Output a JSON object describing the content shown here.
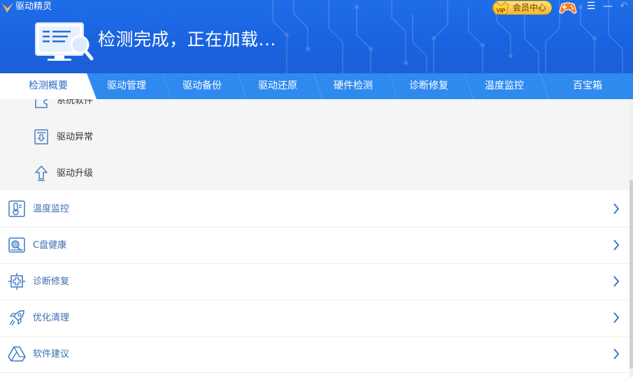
{
  "app": {
    "title": "驱动精灵",
    "vip_label": "会员中心",
    "vip_badge": "VIP"
  },
  "header": {
    "status": "检测完成，正在加载..."
  },
  "tabs": [
    {
      "label": "检测概要",
      "active": true
    },
    {
      "label": "驱动管理",
      "active": false
    },
    {
      "label": "驱动备份",
      "active": false
    },
    {
      "label": "驱动还原",
      "active": false
    },
    {
      "label": "硬件检测",
      "active": false
    },
    {
      "label": "诊断修复",
      "active": false
    },
    {
      "label": "温度监控",
      "active": false
    },
    {
      "label": "百宝箱",
      "active": false
    }
  ],
  "sub_items": [
    {
      "label": "系统软件",
      "icon": "puzzle-icon"
    },
    {
      "label": "驱动异常",
      "icon": "driver-exception-icon"
    },
    {
      "label": "驱动升级",
      "icon": "upgrade-arrow-icon"
    }
  ],
  "nav_rows": [
    {
      "label": "温度监控",
      "icon": "thermometer-icon"
    },
    {
      "label": "C盘健康",
      "icon": "disk-health-icon"
    },
    {
      "label": "诊断修复",
      "icon": "diagnose-repair-icon"
    },
    {
      "label": "优化清理",
      "icon": "rocket-icon"
    },
    {
      "label": "软件建议",
      "icon": "software-suggest-icon"
    }
  ],
  "colors": {
    "header_blue": "#1f6de8",
    "tab_bar": "#2f8af0",
    "nav_text": "#3b6fb3",
    "vip_gold": "#f5b92c"
  }
}
